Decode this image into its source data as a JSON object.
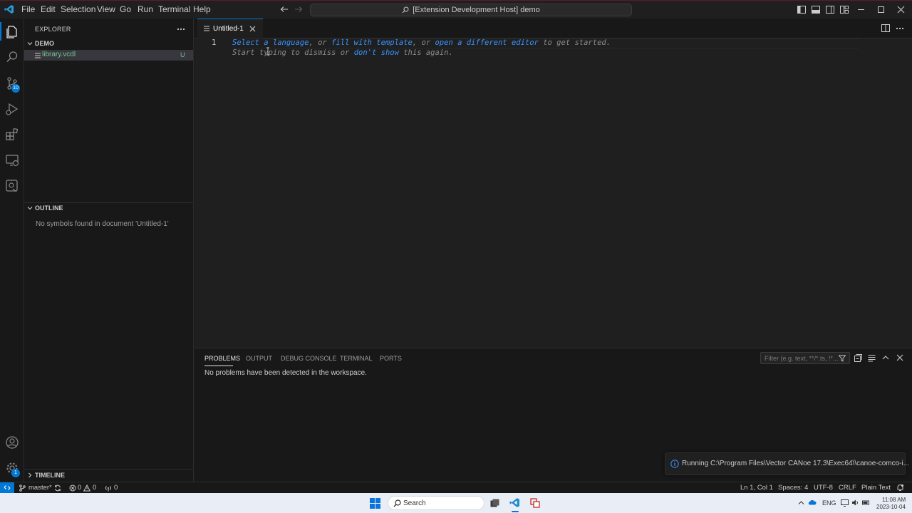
{
  "window": {
    "title": "[Extension Development Host] demo",
    "menu": [
      "File",
      "Edit",
      "Selection",
      "View",
      "Go",
      "Run",
      "Terminal",
      "Help"
    ]
  },
  "activity_bar": {
    "source_control_badge": "10",
    "accounts_badge": "1"
  },
  "sidebar": {
    "header": "EXPLORER",
    "folder": "DEMO",
    "files": [
      {
        "name": "library.vcdl",
        "status": "U"
      }
    ],
    "outline_title": "OUTLINE",
    "outline_message": "No symbols found in document 'Untitled-1'",
    "timeline_title": "TIMELINE"
  },
  "editor": {
    "tab_title": "Untitled-1",
    "line_number": "1",
    "hint_line1": {
      "select_language": "Select a language",
      "or1": ", or ",
      "fill_template": "fill with template",
      "or2": ", or ",
      "open_editor": "open a different editor",
      "tail": " to get started."
    },
    "hint_line2": {
      "start": "Start typing to dismiss or ",
      "dont_show": "don't show",
      "tail": " this again."
    }
  },
  "panel": {
    "tabs": [
      "PROBLEMS",
      "OUTPUT",
      "DEBUG CONSOLE",
      "TERMINAL",
      "PORTS"
    ],
    "active_tab": "PROBLEMS",
    "filter_placeholder": "Filter (e.g. text, **/*.ts, !*...",
    "message": "No problems have been detected in the workspace."
  },
  "notification": {
    "text": "Running C:\\Program Files\\Vector CANoe 17.3\\Exec64\\\\canoe-comco-i..."
  },
  "status_bar": {
    "branch": "master*",
    "errors": "0",
    "warnings": "0",
    "ports": "0",
    "position": "Ln 1, Col 1",
    "spaces": "Spaces: 4",
    "encoding": "UTF-8",
    "eol": "CRLF",
    "language": "Plain Text"
  },
  "taskbar": {
    "search": "Search",
    "lang": "ENG",
    "time": "11:08 AM",
    "date": "2023-10-04"
  },
  "colors": {
    "accent": "#0078d4",
    "link": "#3794ff",
    "background": "#1f1f1f"
  }
}
